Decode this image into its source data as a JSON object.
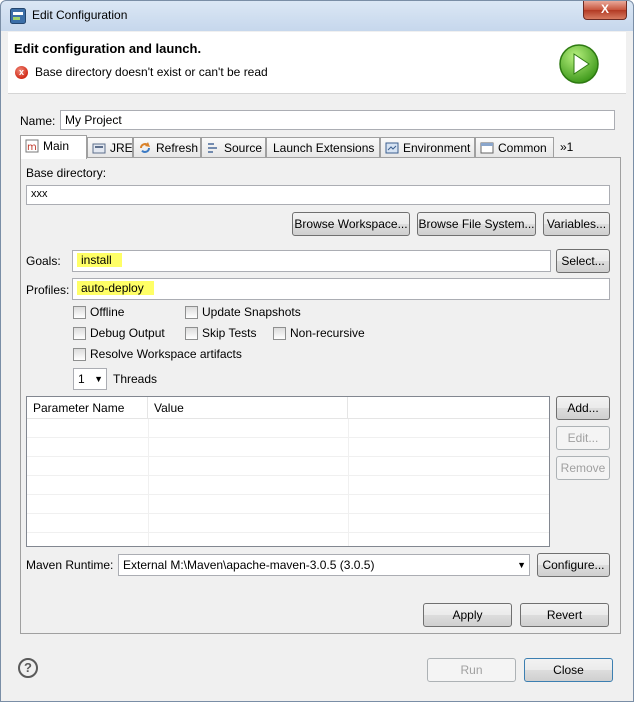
{
  "window": {
    "title": "Edit Configuration",
    "close_glyph": "X"
  },
  "banner": {
    "title": "Edit configuration and launch.",
    "error": "Base directory doesn't exist or can't be read",
    "error_glyph": "x"
  },
  "name": {
    "label": "Name:",
    "value": "My Project"
  },
  "tabs": [
    {
      "label": "Main",
      "icon": "maven-main-icon"
    },
    {
      "label": "JRE",
      "icon": "jre-icon"
    },
    {
      "label": "Refresh",
      "icon": "refresh-icon"
    },
    {
      "label": "Source",
      "icon": "source-icon"
    },
    {
      "label": "Launch Extensions",
      "icon": ""
    },
    {
      "label": "Environment",
      "icon": "environment-icon"
    },
    {
      "label": "Common",
      "icon": "common-icon"
    },
    {
      "label": "»1",
      "icon": ""
    }
  ],
  "main": {
    "base_dir_label": "Base directory:",
    "base_dir_value": "xxx",
    "browse_workspace": "Browse Workspace...",
    "browse_fs": "Browse File System...",
    "variables": "Variables...",
    "goals_label": "Goals:",
    "goals_value": "install",
    "goals_select": "Select...",
    "profiles_label": "Profiles:",
    "profiles_value": "auto-deploy",
    "checks": {
      "offline": "Offline",
      "update_snapshots": "Update Snapshots",
      "debug_output": "Debug Output",
      "skip_tests": "Skip Tests",
      "non_recursive": "Non-recursive",
      "resolve_workspace": "Resolve Workspace artifacts"
    },
    "threads_value": "1",
    "threads_label": "Threads",
    "params": {
      "col_name": "Parameter Name",
      "col_value": "Value",
      "add": "Add...",
      "edit": "Edit...",
      "remove": "Remove"
    },
    "runtime_label": "Maven Runtime:",
    "runtime_value": "External M:\\Maven\\apache-maven-3.0.5 (3.0.5)",
    "configure": "Configure..."
  },
  "actions": {
    "apply": "Apply",
    "revert": "Revert",
    "run": "Run",
    "close": "Close",
    "help": "?"
  }
}
